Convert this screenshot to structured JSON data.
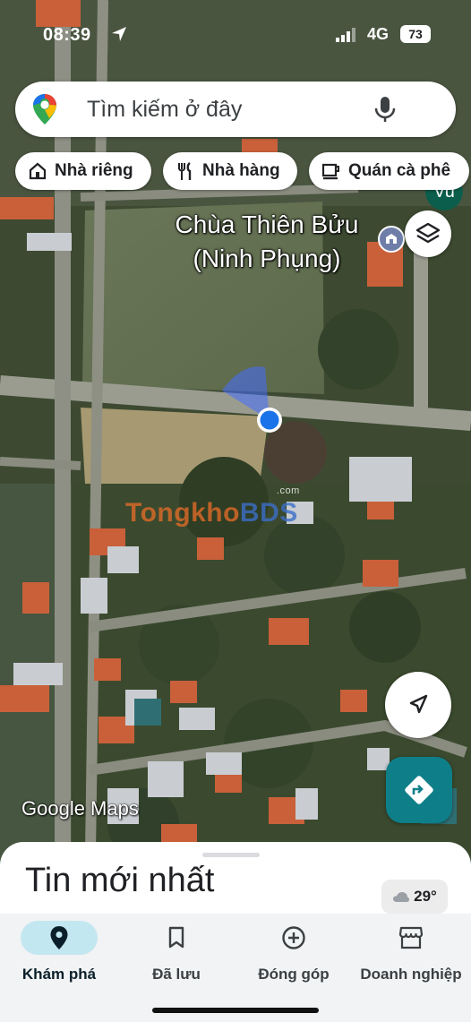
{
  "status_bar": {
    "time": "08:39",
    "network": "4G",
    "battery": "73"
  },
  "search": {
    "placeholder": "Tìm kiếm ở đây",
    "avatar": "Vu"
  },
  "chips": [
    {
      "label": "Nhà riêng",
      "icon": "home-icon"
    },
    {
      "label": "Nhà hàng",
      "icon": "restaurant-icon"
    },
    {
      "label": "Quán cà phê",
      "icon": "coffee-icon"
    }
  ],
  "map": {
    "place_label_line1": "Chùa Thiên Bửu",
    "place_label_line2": "(Ninh Phụng)",
    "watermark_a": "Tongkho",
    "watermark_b": "BDS",
    "watermark_com": ".com",
    "attribution": "Google Maps"
  },
  "sheet": {
    "title": "Tin mới nhất",
    "weather": "29°"
  },
  "nav": [
    {
      "label": "Khám phá",
      "icon": "explore-pin-icon",
      "active": true
    },
    {
      "label": "Đã lưu",
      "icon": "bookmark-icon",
      "active": false
    },
    {
      "label": "Đóng góp",
      "icon": "add-circle-icon",
      "active": false
    },
    {
      "label": "Doanh nghiệp",
      "icon": "storefront-icon",
      "active": false
    }
  ],
  "colors": {
    "accent": "#1a73e8",
    "nav_active": "#c3e7f0",
    "directions_fab": "#0e7f89",
    "avatar": "#0b5e4b"
  }
}
